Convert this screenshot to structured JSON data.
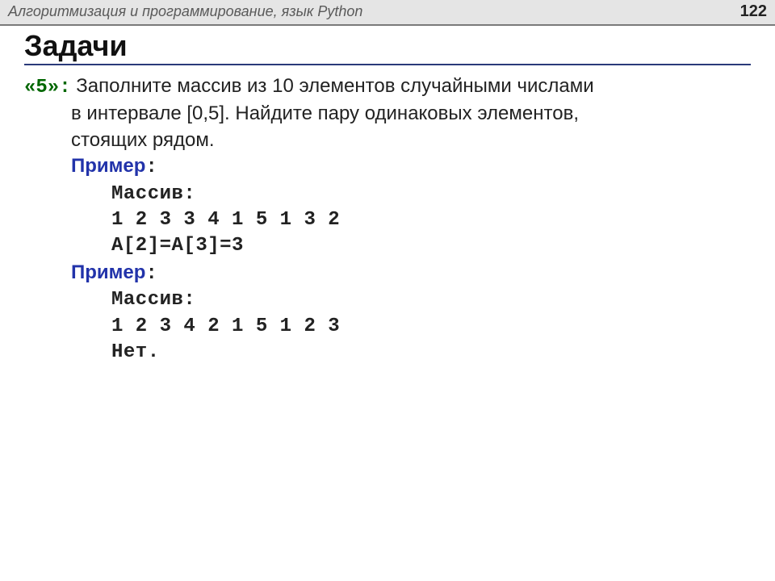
{
  "header": {
    "title": "Алгоритмизация и программирование, язык Python",
    "page": "122"
  },
  "slide": {
    "title": "Задачи"
  },
  "task": {
    "label": "«5»:",
    "line1": " Заполните массив из 10 элементов случайными числами",
    "line2": "в интервале [0,5]. Найдите пару одинаковых элементов,",
    "line3": "стоящих рядом.",
    "example_label": "Пример",
    "colon": ":",
    "ex1": {
      "l1": "Массив:",
      "l2": "1 2 3 3 4 1 5 1 3 2",
      "l3": "A[2]=A[3]=3"
    },
    "ex2": {
      "l1": "Массив:",
      "l2": "1 2 3 4 2 1 5 1 2 3",
      "l3": "Нет."
    }
  }
}
